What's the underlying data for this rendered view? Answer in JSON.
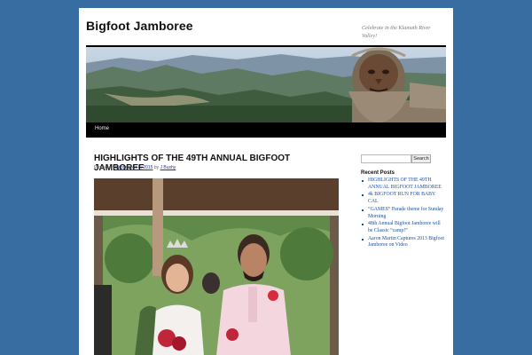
{
  "site": {
    "title": "Bigfoot Jamboree",
    "tagline": "Celebrate in the Klamath River Valley!"
  },
  "nav": {
    "items": [
      {
        "label": "Home"
      }
    ]
  },
  "post": {
    "title": "HIGHLIGHTS OF THE 49TH ANNUAL BIGFOOT JAMBOREE",
    "posted_on_label": "Posted on",
    "date": "September 8, 2015",
    "by_label": "by",
    "author": "J Bushy"
  },
  "sidebar": {
    "search_button": "Search",
    "recent_title": "Recent Posts",
    "recent_posts": [
      "HIGHLIGHTS OF THE 49TH ANNUAL BIGFOOT JAMBOREE",
      "4k BIGFOOT RUN FOR BABY CAL",
      "“GAMES” Parade theme for Sunday Morning",
      "48th Annual Bigfoot Jamboree will be Classic “camp!”",
      "Aaron Martin Captures 2013 Bigfoot Jamboree on Video"
    ]
  },
  "colors": {
    "background": "#386da1",
    "nav_bar": "#000000",
    "link": "#1b4f9a"
  }
}
